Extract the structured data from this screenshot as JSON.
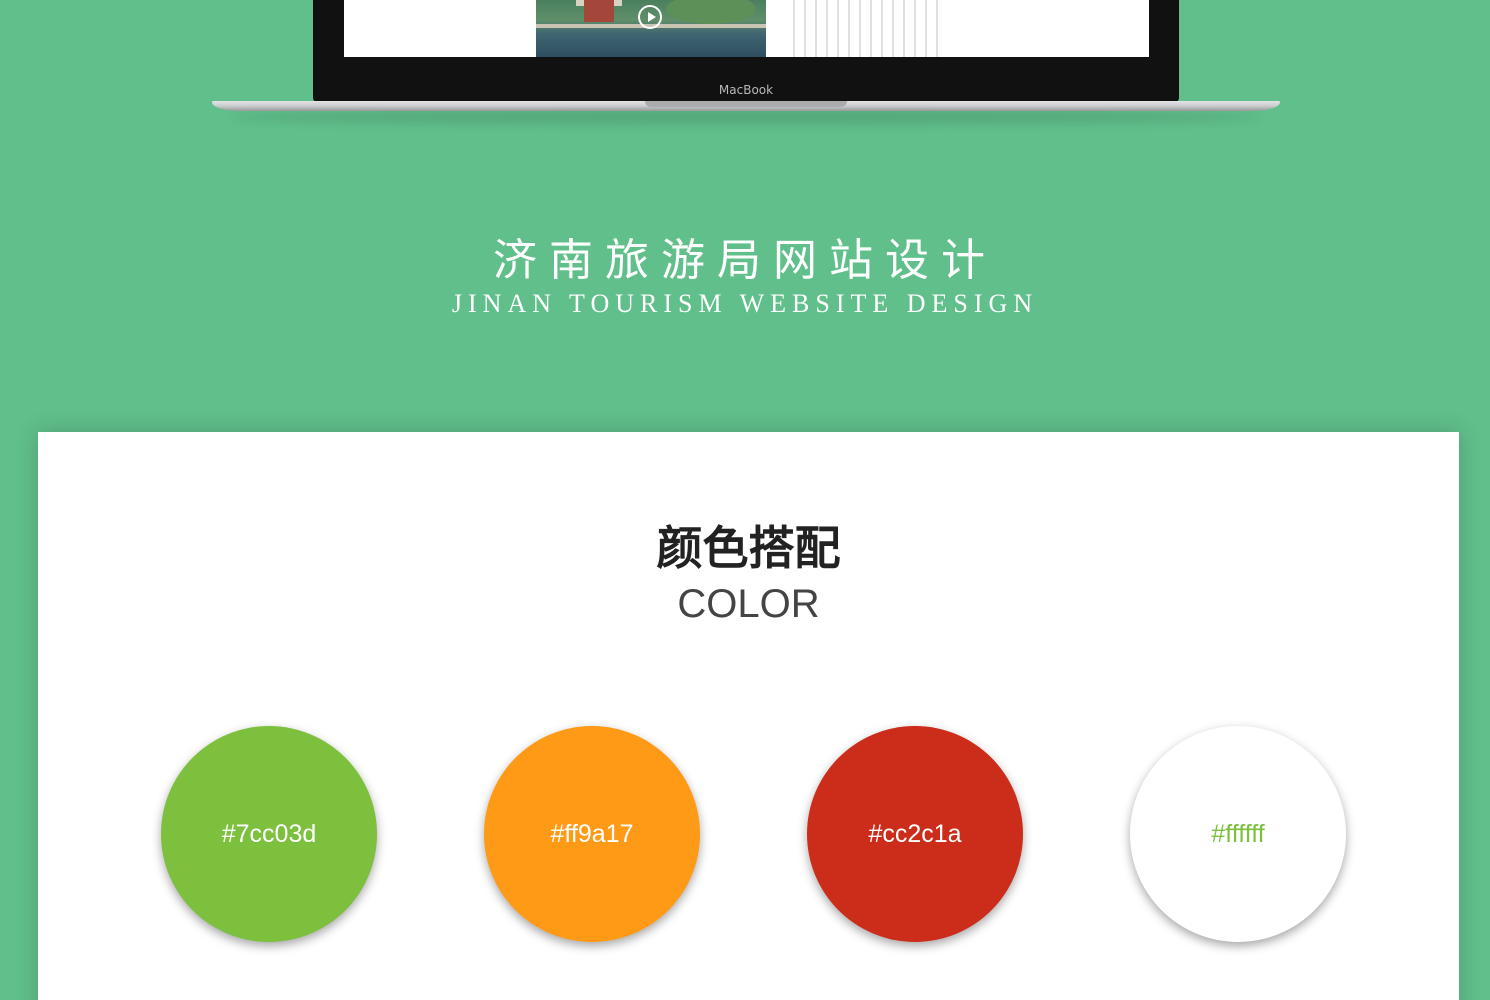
{
  "laptop": {
    "brand": "MacBook"
  },
  "project": {
    "title_cn": "济南旅游局网站设计",
    "title_en": "JINAN TOURISM WEBSITE DESIGN"
  },
  "color_section": {
    "title": "颜色搭配",
    "subtitle": "COLOR",
    "swatches": [
      {
        "label": "#7cc03d",
        "fill": "#7cc03d",
        "text_color": "#ffffff"
      },
      {
        "label": "#ff9a17",
        "fill": "#ff9a17",
        "text_color": "#ffffff"
      },
      {
        "label": "#cc2c1a",
        "fill": "#cc2c1a",
        "text_color": "#ffffff"
      },
      {
        "label": "#ffffff",
        "fill": "#ffffff",
        "text_color": "#7cc03d"
      }
    ]
  },
  "colors": {
    "background": "#60bf8b",
    "panel": "#ffffff"
  }
}
